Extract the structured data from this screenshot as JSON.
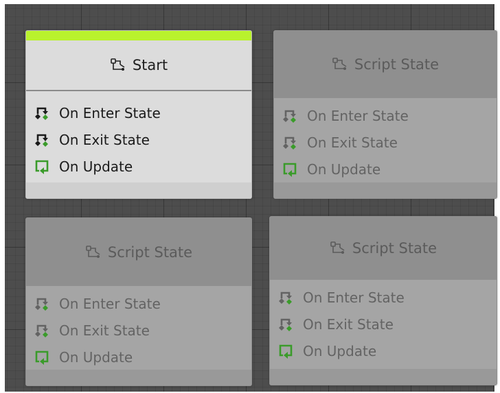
{
  "colors": {
    "canvas_background": "#4d4d4d",
    "active_node_bar": "#b9f22d",
    "active_node_background": "#dcdcdc",
    "inactive_node_background": "#9c9c9c",
    "event_icon_green": "#3a9b2a"
  },
  "icons": {
    "state_icon": "state-node-icon",
    "enter_exit_icon": "transition-arrow-icon",
    "update_icon": "loop-arrow-icon"
  },
  "nodes": [
    {
      "title": "Start",
      "active": true,
      "events": [
        "On Enter State",
        "On Exit State",
        "On Update"
      ]
    },
    {
      "title": "Script State",
      "active": false,
      "events": [
        "On Enter State",
        "On Exit State",
        "On Update"
      ]
    },
    {
      "title": "Script State",
      "active": false,
      "events": [
        "On Enter State",
        "On Exit State",
        "On Update"
      ]
    },
    {
      "title": "Script State",
      "active": false,
      "events": [
        "On Enter State",
        "On Exit State",
        "On Update"
      ]
    }
  ]
}
